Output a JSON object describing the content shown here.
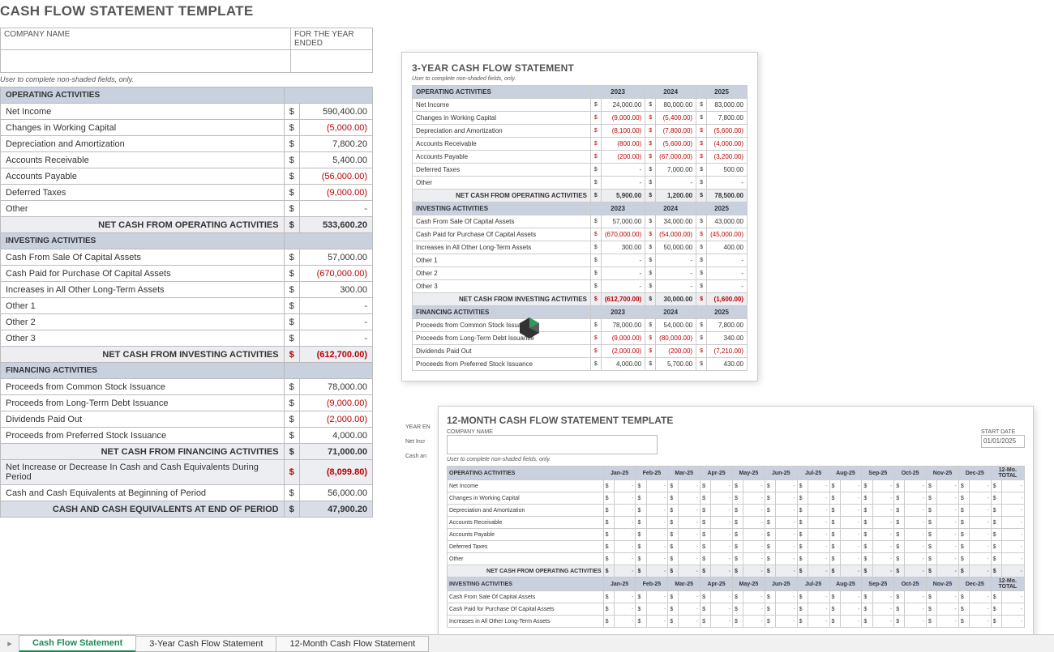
{
  "title_main": "CASH FLOW STATEMENT TEMPLATE",
  "hdr_company": "COMPANY NAME",
  "hdr_year": "FOR THE YEAR ENDED",
  "note": "User to complete non-shaded fields, only.",
  "sect_op": "OPERATING ACTIVITIES",
  "sect_inv": "INVESTING ACTIVITIES",
  "sect_fin": "FINANCING ACTIVITIES",
  "sub_op": "NET CASH FROM OPERATING ACTIVITIES",
  "sub_inv": "NET CASH FROM INVESTING ACTIVITIES",
  "sub_fin": "NET CASH FROM FINANCING ACTIVITIES",
  "row_netinc": "Net Income",
  "row_cwc": "Changes in Working Capital",
  "row_dep": "Depreciation and Amortization",
  "row_ar": "Accounts Receivable",
  "row_ap": "Accounts Payable",
  "row_dt": "Deferred Taxes",
  "row_other": "Other",
  "row_other1": "Other 1",
  "row_other2": "Other 2",
  "row_other3": "Other 3",
  "row_salecap": "Cash From Sale Of Capital Assets",
  "row_purchcap": "Cash Paid for Purchase Of Capital Assets",
  "row_inc_lta": "Increases in All Other Long-Term Assets",
  "row_pcsi": "Proceeds from Common Stock Issuance",
  "row_pltdi": "Proceeds from Long-Term Debt Issuance",
  "row_div": "Dividends Paid Out",
  "row_ppsi": "Proceeds from Preferred Stock Issuance",
  "row_netchg": "Net Increase or Decrease In Cash and Cash Equivalents During Period",
  "row_begcash": "Cash and Cash Equivalents at Beginning of Period",
  "row_endcash": "CASH AND CASH EQUIVALENTS AT END OF PERIOD",
  "cur": "$",
  "dash": "-",
  "main": {
    "netinc": "590,400.00",
    "cwc": "(5,000.00)",
    "dep": "7,800.20",
    "ar": "5,400.00",
    "ap": "(56,000.00)",
    "dt": "(9,000.00)",
    "sub_op": "533,600.20",
    "salecap": "57,000.00",
    "purchcap": "(670,000.00)",
    "inc_lta": "300.00",
    "sub_inv": "(612,700.00)",
    "pcsi": "78,000.00",
    "pltdi": "(9,000.00)",
    "div": "(2,000.00)",
    "ppsi": "4,000.00",
    "sub_fin": "71,000.00",
    "netchg": "(8,099.80)",
    "begcash": "56,000.00",
    "endcash": "47,900.20"
  },
  "title_y3": "3-YEAR CASH FLOW STATEMENT",
  "y3": {
    "years": [
      "2023",
      "2024",
      "2025"
    ],
    "netinc": [
      "24,000.00",
      "80,000.00",
      "83,000.00"
    ],
    "cwc": [
      "(9,000.00)",
      "(5,400.00)",
      "7,800.00"
    ],
    "dep": [
      "(8,100.00)",
      "(7,800.00)",
      "(5,600.00)"
    ],
    "ar": [
      "(800.00)",
      "(5,600.00)",
      "(4,000.00)"
    ],
    "ap": [
      "(200.00)",
      "(67,000.00)",
      "(3,200.00)"
    ],
    "dt": [
      "-",
      "7,000.00",
      "500.00"
    ],
    "other": [
      "-",
      "-",
      "-"
    ],
    "sub_op": [
      "5,900.00",
      "1,200.00",
      "78,500.00"
    ],
    "salecap": [
      "57,000.00",
      "34,000.00",
      "43,000.00"
    ],
    "purchcap": [
      "(670,000.00)",
      "(54,000.00)",
      "(45,000.00)"
    ],
    "inc_lta": [
      "300.00",
      "50,000.00",
      "400.00"
    ],
    "o1": [
      "-",
      "-",
      "-"
    ],
    "o2": [
      "-",
      "-",
      "-"
    ],
    "o3": [
      "-",
      "-",
      "-"
    ],
    "sub_inv": [
      "(612,700.00)",
      "30,000.00",
      "(1,600.00)"
    ],
    "pcsi": [
      "78,000.00",
      "54,000.00",
      "7,800.00"
    ],
    "pltdi": [
      "(9,000.00)",
      "(80,000.00)",
      "340.00"
    ],
    "div": [
      "(2,000.00)",
      "(200.00)",
      "(7,210.00)"
    ],
    "ppsi": [
      "4,000.00",
      "5,700.00",
      "430.00"
    ]
  },
  "title_m12": "12-MONTH CASH FLOW STATEMENT TEMPLATE",
  "m12": {
    "company_lbl": "COMPANY NAME",
    "start_lbl": "START DATE",
    "start_date": "01/01/2025",
    "months": [
      "Jan-25",
      "Feb-25",
      "Mar-25",
      "Apr-25",
      "May-25",
      "Jun-25",
      "Jul-25",
      "Aug-25",
      "Sep-25",
      "Oct-25",
      "Nov-25",
      "Dec-25"
    ],
    "total_hdr": "12-Mo. TOTAL"
  },
  "left_fragment_yearend": "YEAR EN",
  "left_fragment_netinc": "Net Incr",
  "left_fragment_cash": "Cash an",
  "tabs": {
    "t1": "Cash Flow Statement",
    "t2": "3-Year Cash Flow Statement",
    "t3": "12-Month Cash Flow Statement"
  }
}
